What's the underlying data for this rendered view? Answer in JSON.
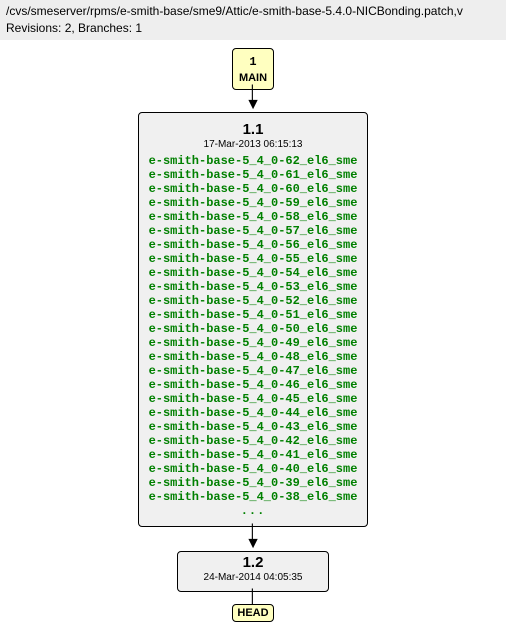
{
  "header": {
    "path": "/cvs/smeserver/rpms/e-smith-base/sme9/Attic/e-smith-base-5.4.0-NICBonding.patch,v",
    "revisions_line": "Revisions: 2, Branches: 1"
  },
  "branch_top": {
    "number": "1",
    "name": "MAIN"
  },
  "rev_1_1": {
    "num": "1.1",
    "date": "17-Mar-2013 06:15:13",
    "tags": [
      "e-smith-base-5_4_0-62_el6_sme",
      "e-smith-base-5_4_0-61_el6_sme",
      "e-smith-base-5_4_0-60_el6_sme",
      "e-smith-base-5_4_0-59_el6_sme",
      "e-smith-base-5_4_0-58_el6_sme",
      "e-smith-base-5_4_0-57_el6_sme",
      "e-smith-base-5_4_0-56_el6_sme",
      "e-smith-base-5_4_0-55_el6_sme",
      "e-smith-base-5_4_0-54_el6_sme",
      "e-smith-base-5_4_0-53_el6_sme",
      "e-smith-base-5_4_0-52_el6_sme",
      "e-smith-base-5_4_0-51_el6_sme",
      "e-smith-base-5_4_0-50_el6_sme",
      "e-smith-base-5_4_0-49_el6_sme",
      "e-smith-base-5_4_0-48_el6_sme",
      "e-smith-base-5_4_0-47_el6_sme",
      "e-smith-base-5_4_0-46_el6_sme",
      "e-smith-base-5_4_0-45_el6_sme",
      "e-smith-base-5_4_0-44_el6_sme",
      "e-smith-base-5_4_0-43_el6_sme",
      "e-smith-base-5_4_0-42_el6_sme",
      "e-smith-base-5_4_0-41_el6_sme",
      "e-smith-base-5_4_0-40_el6_sme",
      "e-smith-base-5_4_0-39_el6_sme",
      "e-smith-base-5_4_0-38_el6_sme"
    ],
    "ellipsis": "..."
  },
  "rev_1_2": {
    "num": "1.2",
    "date": "24-Mar-2014 04:05:35"
  },
  "branch_bottom": {
    "name": "HEAD"
  }
}
